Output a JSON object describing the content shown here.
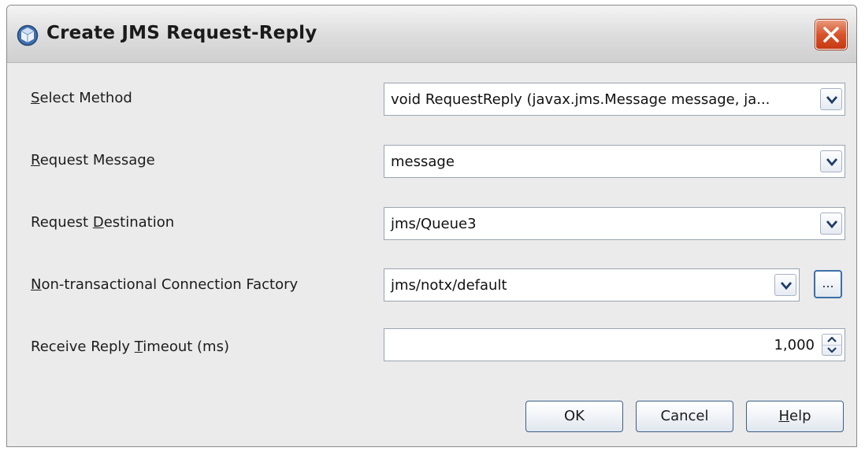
{
  "window": {
    "title": "Create JMS Request-Reply",
    "icon": "netbeans-cube-icon"
  },
  "form": {
    "select_method": {
      "label_pre": "",
      "label_mn": "S",
      "label_post": "elect Method",
      "value": "void RequestReply (javax.jms.Message message, ja..."
    },
    "request_message": {
      "label_pre": "",
      "label_mn": "R",
      "label_post": "equest Message",
      "value": "message"
    },
    "request_destination": {
      "label_pre": "Request ",
      "label_mn": "D",
      "label_post": "estination",
      "value": "jms/Queue3"
    },
    "connection_factory": {
      "label_pre": "",
      "label_mn": "N",
      "label_post": "on-transactional Connection Factory",
      "value": "jms/notx/default",
      "browse_label": "..."
    },
    "reply_timeout": {
      "label_pre": "Receive Reply ",
      "label_mn": "T",
      "label_post": "imeout (ms)",
      "value": "1,000"
    }
  },
  "buttons": {
    "ok": "OK",
    "cancel": "Cancel",
    "help_mn": "H",
    "help_rest": "elp"
  },
  "colors": {
    "close_button": "#d8532a",
    "focus_border": "#3c6fa8",
    "dialog_bg": "#ebebeb"
  }
}
